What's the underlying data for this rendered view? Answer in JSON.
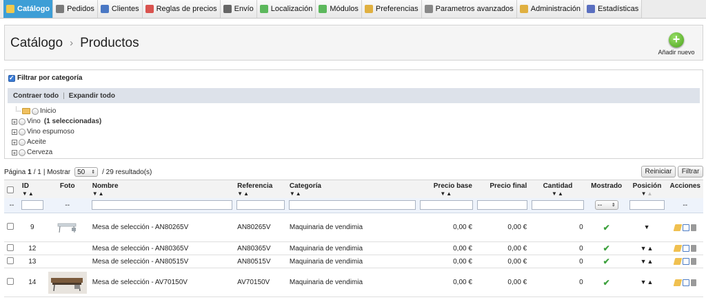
{
  "tabs": [
    {
      "label": "Catálogo",
      "icon": "folder-icon",
      "active": true,
      "color": "#f2c94c"
    },
    {
      "label": "Pedidos",
      "icon": "cart-icon",
      "active": false,
      "color": "#7a7a7a"
    },
    {
      "label": "Clientes",
      "icon": "user-icon",
      "active": false,
      "color": "#4a78c4"
    },
    {
      "label": "Reglas de precios",
      "icon": "price-rules-icon",
      "active": false,
      "color": "#d9534f"
    },
    {
      "label": "Envío",
      "icon": "truck-icon",
      "active": false,
      "color": "#666666"
    },
    {
      "label": "Localización",
      "icon": "globe-icon",
      "active": false,
      "color": "#5cb85c"
    },
    {
      "label": "Módulos",
      "icon": "puzzle-icon",
      "active": false,
      "color": "#5cb85c"
    },
    {
      "label": "Preferencias",
      "icon": "preferences-icon",
      "active": false,
      "color": "#e0b040"
    },
    {
      "label": "Parametros avanzados",
      "icon": "wrench-icon",
      "active": false,
      "color": "#888888"
    },
    {
      "label": "Administración",
      "icon": "key-icon",
      "active": false,
      "color": "#e0b040"
    },
    {
      "label": "Estadísticas",
      "icon": "bar-chart-icon",
      "active": false,
      "color": "#5a6fc0"
    }
  ],
  "breadcrumb": {
    "parent": "Catálogo",
    "separator": "›",
    "current": "Productos"
  },
  "add_new": {
    "label": "Añadir nuevo",
    "icon": "add-circle-icon"
  },
  "filter": {
    "checkbox_label": "Filtrar por categoría",
    "checked": true,
    "collapse_all": "Contraer todo",
    "separator": "|",
    "expand_all": "Expandir todo",
    "root": "Inicio",
    "categories": [
      {
        "name": "Vino",
        "extra": "(1 seleccionadas)"
      },
      {
        "name": "Vino espumoso",
        "extra": ""
      },
      {
        "name": "Aceite",
        "extra": ""
      },
      {
        "name": "Cerveza",
        "extra": ""
      }
    ]
  },
  "pagination": {
    "page_label": "Página",
    "page": "1",
    "total_pages": "/ 1",
    "show_label": "| Mostrar",
    "per_page": "50",
    "results": "/ 29 resultado(s)",
    "reset_label": "Reiniciar",
    "filter_label": "Filtrar"
  },
  "table": {
    "headers": {
      "id": "ID",
      "photo": "Foto",
      "name": "Nombre",
      "reference": "Referencia",
      "category": "Categoría",
      "base_price": "Precio base",
      "final_price": "Precio final",
      "quantity": "Cantidad",
      "shown": "Mostrado",
      "position": "Posición",
      "actions": "Acciones"
    },
    "filter_placeholder": "--",
    "shown_select": "--",
    "rows": [
      {
        "id": "9",
        "name": "Mesa de selección - AN80265V",
        "reference": "AN80265V",
        "category": "Maquinaria de vendimia",
        "base_price": "0,00 €",
        "final_price": "0,00 €",
        "quantity": "0",
        "position": "▼",
        "photo": "small",
        "tall": true
      },
      {
        "id": "12",
        "name": "Mesa de selección - AN80365V",
        "reference": "AN80365V",
        "category": "Maquinaria de vendimia",
        "base_price": "0,00 €",
        "final_price": "0,00 €",
        "quantity": "0",
        "position": "▼▲",
        "photo": "",
        "tall": false
      },
      {
        "id": "13",
        "name": "Mesa de selección - AN80515V",
        "reference": "AN80515V",
        "category": "Maquinaria de vendimia",
        "base_price": "0,00 €",
        "final_price": "0,00 €",
        "quantity": "0",
        "position": "▼▲",
        "photo": "",
        "tall": false
      },
      {
        "id": "14",
        "name": "Mesa de selección - AV70150V",
        "reference": "AV70150V",
        "category": "Maquinaria de vendimia",
        "base_price": "0,00 €",
        "final_price": "0,00 €",
        "quantity": "0",
        "position": "▼▲",
        "photo": "large",
        "tall": true
      }
    ]
  }
}
